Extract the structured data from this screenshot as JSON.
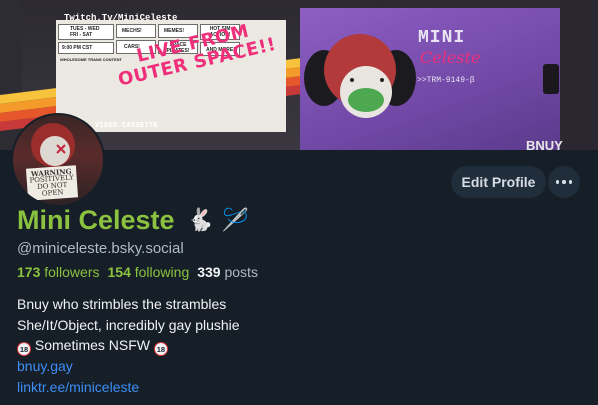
{
  "banner": {
    "cassette_title": "Twitch.Tv/MiniCeleste",
    "live_line1": "LIVE FROM",
    "live_line2": "OUTER SPACE!!",
    "logo_mini": "MINI",
    "logo_celeste": "Celeste",
    "logo_code": ">>TRM-9149-β",
    "video_cassette": "VIDEO CASSETTE",
    "bnuy_mark": "BNUY",
    "label_cells": {
      "days": "TUES - WED",
      "days2": "FRI - SAT",
      "time": "9:00 PM CST",
      "mechs": "MECHS!",
      "memes": "MEMES!",
      "cars": "CARS!",
      "space": "SPACE PIRATES!",
      "hot": "HOT SIM ACTION!",
      "more": "AND MORE!",
      "wholesome": "WHOLESOME TRANS CONTENT"
    }
  },
  "avatar": {
    "sign_line1": "WARNING",
    "sign_line2": "POSITIVELY",
    "sign_line3": "DO NOT",
    "sign_line4": "OPEN"
  },
  "actions": {
    "edit_profile": "Edit Profile",
    "more_icon": "ellipsis-icon"
  },
  "profile": {
    "display_name": "Mini Celeste",
    "name_emoji": "🐇 🪡",
    "handle": "@miniceleste.bsky.social",
    "followers_count": "173",
    "followers_label": "followers",
    "following_count": "154",
    "following_label": "following",
    "posts_count": "339",
    "posts_label": "posts"
  },
  "bio": {
    "line1": "Bnuy who strimbles the strambles",
    "line2": "She/It/Object, incredibly gay plushie",
    "line3_badge": "18",
    "line3_text": " Sometimes NSFW ",
    "link1": "bnuy.gay",
    "link2": "linktr.ee/miniceleste"
  },
  "colors": {
    "background": "#161e27",
    "accent_green": "#8bc23f",
    "link_blue": "#3d8ff5",
    "button_bg": "#202d3a",
    "muted_text": "#aebbc9"
  }
}
